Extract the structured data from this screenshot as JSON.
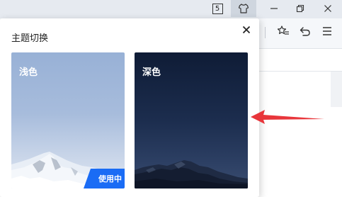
{
  "titlebar": {
    "tab_counter": "5",
    "icons": [
      "tab-counter-icon",
      "skin-icon",
      "minimize-icon",
      "maximize-icon",
      "close-icon"
    ]
  },
  "toolbar": {
    "icons": [
      "favorite-icon",
      "undo-icon",
      "menu-icon"
    ]
  },
  "popup": {
    "title": "主题切换",
    "close_icon": "close-icon",
    "themes": [
      {
        "label": "浅色",
        "active": true,
        "badge": "使用中",
        "style": "light"
      },
      {
        "label": "深色",
        "active": false,
        "style": "dark"
      }
    ]
  },
  "annotation": {
    "arrow_color": "#e8363b"
  },
  "colors": {
    "accent": "#1a6cf5",
    "light_theme": "#a7bcdc",
    "dark_theme": "#1c2d4e"
  }
}
